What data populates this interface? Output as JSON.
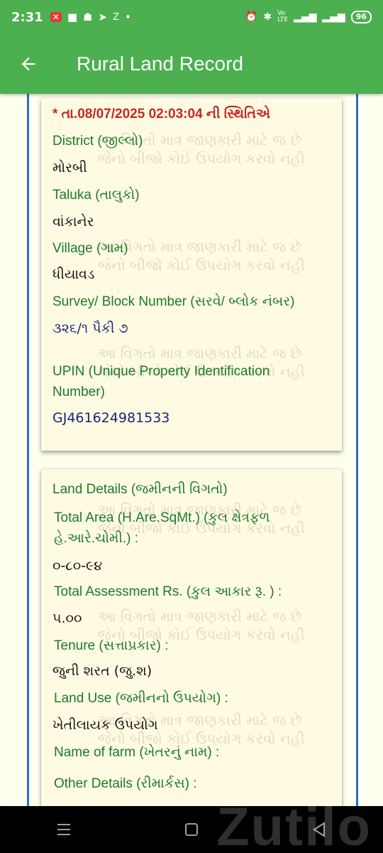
{
  "status_bar": {
    "time": "2:31",
    "battery": "96",
    "left_icons": [
      "notification-app-icon",
      "flipboard-icon",
      "snapchat-icon",
      "telegram-icon",
      "zee5-icon",
      "dot-icon"
    ],
    "right_icons": [
      "alarm-icon",
      "bluetooth-icon",
      "volte-icon",
      "4g-signal-icon",
      "signal-icon",
      "battery-icon"
    ]
  },
  "app_bar": {
    "title": "Rural Land Record"
  },
  "watermark": {
    "line1": "આ વિગતો માત્ર જાણકારી માટે જ છે",
    "line2": "જેનો બીજો કોઈ ઉપયોગ કરવો નહી"
  },
  "record_card": {
    "status_stamp": "* તા.08/07/2025 02:03:04 ની સ્થિતિએ",
    "district_label": "District (જીલ્લો)",
    "district_value": "મોરબી",
    "taluka_label": "Taluka (તાલુકો)",
    "taluka_value": "વાંકાનેર",
    "village_label": "Village (ગામ)",
    "village_value": "ધીયાવડ",
    "survey_label": "Survey/ Block Number (સરવે/ બ્લોક નંબર)",
    "survey_value": "૩૨૬/૧ પૈકી ૭",
    "upin_label_line1": "UPIN (Unique Property Identification",
    "upin_label_line2": "Number)",
    "upin_value": "GJ461624981533"
  },
  "land_details_card": {
    "heading": "Land Details (જમીનની વિગતો)",
    "total_area_label_line1": "Total Area (H.Are.SqMt.) (કુલ ક્ષેત્રફળ",
    "total_area_label_line2": "હે.આરે.ચોમી.) :",
    "total_area_value": "૦-૮૦-૯૪",
    "assessment_label": "Total Assessment Rs. (કુલ આકાર રૂ. ) :",
    "assessment_value": "૫.૦૦",
    "tenure_label": "Tenure (સત્તાપ્રકાર) :",
    "tenure_value": "જુની શરત (જુ.શ)",
    "land_use_label": "Land Use (જમીનનો ઉપયોગ) :",
    "land_use_value": "ખેતીલાયક ઉપયોગ",
    "farm_name_label": "Name of farm (ખેતરનું નામ) :",
    "other_details_label": "Other Details (રીમાર્કસ) :"
  },
  "nav_bar": {
    "buttons": [
      "menu-icon",
      "home-icon",
      "back-icon"
    ],
    "brand_watermark": "Zutilo"
  },
  "colors": {
    "app_bar": "#4caf50",
    "label_green": "#1b7a2a",
    "stamp_red": "#c62828",
    "value_blue": "#1a237e",
    "rail_blue": "#2a6fc9",
    "card_bg": "#fffbe2"
  }
}
